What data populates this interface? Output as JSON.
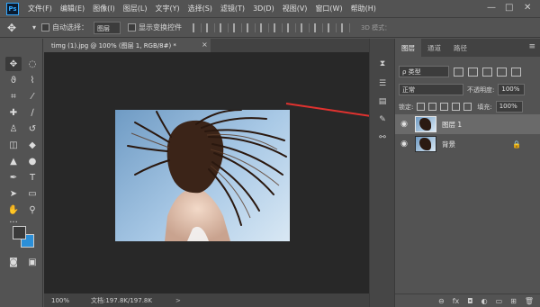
{
  "app": {
    "logo": "Ps"
  },
  "menu": [
    "文件(F)",
    "编辑(E)",
    "图像(I)",
    "图层(L)",
    "文字(Y)",
    "选择(S)",
    "滤镜(T)",
    "3D(D)",
    "视图(V)",
    "窗口(W)",
    "帮助(H)"
  ],
  "window_controls": {
    "minimize": "—",
    "maximize": "□",
    "close": "✕"
  },
  "options": {
    "auto_select_label": "自动选择：",
    "auto_select_value": "图层",
    "transform_label": "显示变换控件",
    "mode_3d": "3D 模式："
  },
  "document": {
    "tab_title": "timg (1).jpg @ 100% (图层 1, RGB/8#) *",
    "tab_close": "×",
    "zoom": "100%",
    "doc_info": "文档:197.8K/197.8K",
    "status_arrow": ">"
  },
  "layers_panel": {
    "tabs": [
      "图层",
      "通道",
      "路径"
    ],
    "active_tab": 0,
    "filter_label": "ρ 类型",
    "blend_mode": "正常",
    "opacity_label": "不透明度:",
    "opacity_value": "100%",
    "lock_label": "锁定:",
    "fill_label": "填充:",
    "fill_value": "100%",
    "layers": [
      {
        "name": "图层 1",
        "selected": true,
        "locked": false
      },
      {
        "name": "背景",
        "selected": false,
        "locked": true
      }
    ],
    "bottom_icons": [
      "link-icon",
      "fx-icon",
      "mask-icon",
      "adjustment-icon",
      "group-icon",
      "new-layer-icon",
      "delete-icon"
    ],
    "bottom_labels": [
      "⊖",
      "fx",
      "◘",
      "◐",
      "▭",
      "⊞",
      "🗑"
    ]
  },
  "colors": {
    "foreground": "#3a3a3a",
    "background": "#2b8fd8",
    "arrow": "#e0322f",
    "selected_layer": "#6a6a6a"
  }
}
